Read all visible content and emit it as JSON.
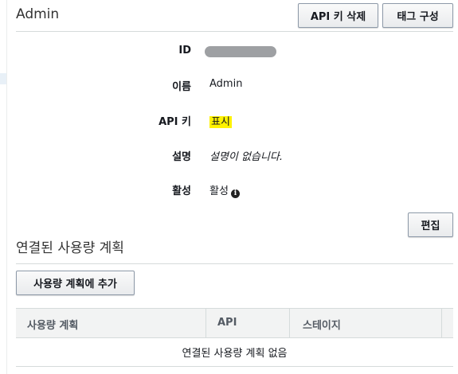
{
  "header": {
    "title": "Admin",
    "delete_key_label": "API 키 삭제",
    "tag_config_label": "태그 구성"
  },
  "details": {
    "id_label": "ID",
    "name_label": "이름",
    "name_value": "Admin",
    "api_key_label": "API 키",
    "api_key_value": "표시",
    "description_label": "설명",
    "description_value": "설명이 없습니다.",
    "status_label": "활성",
    "status_value": "활성",
    "edit_label": "편집"
  },
  "usage_plans": {
    "title": "연결된 사용량 계획",
    "add_button_label": "사용량 계획에 추가",
    "columns": [
      "사용량 계획",
      "API",
      "스테이지"
    ],
    "empty_text": "연결된 사용량 계획 없음"
  },
  "colors": {
    "highlight": "#fff200",
    "redaction": "#9ea0a3",
    "table_header_bg": "#f2f3f3"
  }
}
